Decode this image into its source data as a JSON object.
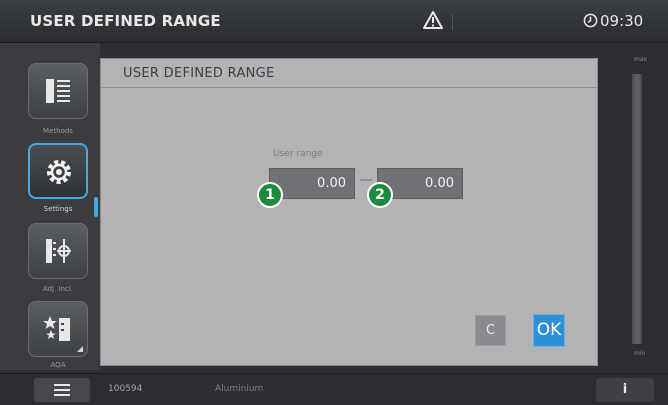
{
  "header": {
    "title": "USER DEFINED RANGE",
    "time": "09:30",
    "icons": [
      "warning-icon",
      "clock-icon"
    ]
  },
  "sidebar": {
    "items": [
      {
        "label": "Methods",
        "icon": "methods-list-icon",
        "active": false
      },
      {
        "label": "Settings",
        "icon": "gear-icon",
        "active": true
      },
      {
        "label": "Adj. Incl.",
        "icon": "adjust-icon",
        "active": false
      },
      {
        "label": "AQA",
        "icon": "stars-icon",
        "active": false
      }
    ]
  },
  "dialog": {
    "title": "USER DEFINED RANGE",
    "range_label": "User range",
    "range_from": "0.00",
    "range_to": "0.00",
    "marker_1": "1",
    "marker_2": "2",
    "clear_label": "C",
    "ok_label": "OK"
  },
  "gauge": {
    "max_label": "max",
    "min_label": "min"
  },
  "footer": {
    "method_number": "100594",
    "method_name": "Aluminium",
    "info_label": "i"
  },
  "colors": {
    "accent": "#2d8fd5",
    "marker": "#1e8a3e",
    "dialog_bg": "#b2b3b5"
  }
}
